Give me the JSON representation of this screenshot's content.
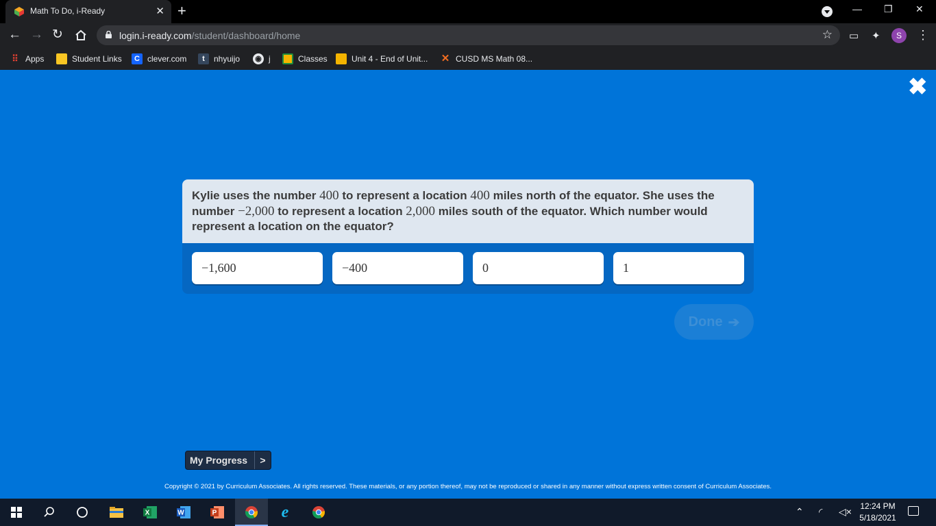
{
  "browser": {
    "tab_title": "Math To Do, i-Ready",
    "new_tab": "+",
    "url_host": "login.i-ready.com",
    "url_path": "/student/dashboard/home",
    "profile_initial": "S",
    "bookmarks": [
      {
        "label": "Apps",
        "icon": "apps-grid-icon"
      },
      {
        "label": "Student Links",
        "icon": "folder-icon"
      },
      {
        "label": "clever.com",
        "icon": "clever-icon"
      },
      {
        "label": "nhyuijo",
        "icon": "tumblr-icon"
      },
      {
        "label": "j",
        "icon": "globe-icon"
      },
      {
        "label": "Classes",
        "icon": "classroom-icon"
      },
      {
        "label": "Unit 4 - End of Unit...",
        "icon": "slides-icon"
      },
      {
        "label": "CUSD MS Math 08...",
        "icon": "desmos-icon"
      }
    ]
  },
  "lesson": {
    "question_parts": {
      "p1": "Kylie uses the number ",
      "n1": "400",
      "p2": " to represent a location ",
      "n2": "400",
      "p3": " miles north of the equator. She uses the number ",
      "n3": "−2,000",
      "p4": " to represent a location ",
      "n4": "2,000",
      "p5": " miles south of the equator. Which number would represent a location on the equator?"
    },
    "choices": [
      "−1,600",
      "−400",
      "0",
      "1"
    ],
    "done_label": "Done",
    "done_arrow": "➔"
  },
  "footer": {
    "progress_label": "My Progress",
    "progress_chevron": ">",
    "copyright": "Copyright © 2021 by Curriculum Associates. All rights reserved. These materials, or any portion thereof, may not be reproduced or shared in any manner without express written consent of Curriculum Associates."
  },
  "taskbar": {
    "time": "12:24 PM",
    "date": "5/18/2021",
    "apps": [
      "start-icon",
      "search-icon",
      "cortana-icon",
      "file-explorer-icon",
      "excel-icon",
      "word-icon",
      "powerpoint-icon",
      "chrome-icon",
      "internet-explorer-icon",
      "chrome-icon"
    ]
  },
  "colors": {
    "page_background": "#0074d9",
    "question_background": "#dfe7f0",
    "choices_background": "#0567c2"
  }
}
